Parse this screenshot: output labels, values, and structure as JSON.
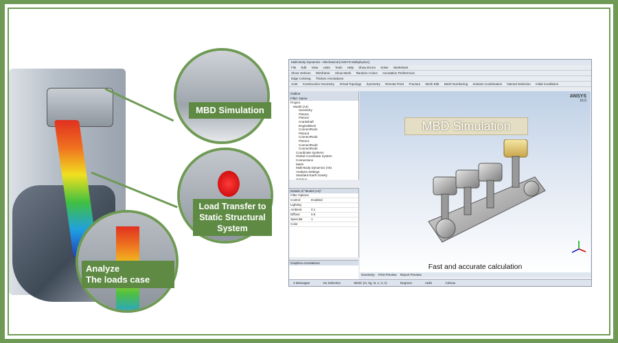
{
  "illustration": {
    "labels": {
      "mbd_simulation": "MBD Simulation",
      "load_transfer": [
        "Load Transfer to",
        "Static Structural",
        "System"
      ],
      "analyze": [
        "Analyze",
        "The loads case"
      ]
    }
  },
  "app": {
    "title": "Multi-Body Dynamics - Mechanical [ANSYS Multiphysics]",
    "menu": [
      "File",
      "Edit",
      "View",
      "Units",
      "Tools",
      "Help"
    ],
    "toolbar1": [
      "Show Errors",
      "Solve",
      "Worksheet"
    ],
    "toolbar2": [
      "Show Vertices",
      "Wireframe",
      "Show Mesh",
      "Random Colors",
      "Annotation Preferences"
    ],
    "toolbar3": [
      "Edge Coloring",
      "Thicken Annotations"
    ],
    "toolbar4": [
      "Joint",
      "Construction Geometry",
      "Virtual Topology",
      "Symmetry",
      "Remote Point",
      "Fracture",
      "Mesh Edit",
      "Mesh Numbering",
      "Solution Combination",
      "Named Selection",
      "Initial Conditions"
    ],
    "tree_header": [
      "Filter:",
      "Name"
    ],
    "tree_title": "Outline",
    "tree": [
      "Project",
      "Model (A4)",
      "Geometry",
      "Piston1",
      "Piston2",
      "Crankshaft",
      "EngineBlock",
      "ConnectRod1",
      "Piston3",
      "ConnectRod2",
      "Piston4",
      "ConnectRod3",
      "ConnectRod4",
      "Coordinate Systems",
      "Global Coordinate System",
      "Connections",
      "Mesh",
      "Multi-Body Dynamics (A5)",
      "Analysis Settings",
      "Standard Earth Gravity",
      "Solution",
      "Results",
      "Simulation"
    ],
    "details_title": "Details of \"Model (A4)\"",
    "details": [
      {
        "k": "Filter Options",
        "v": ""
      },
      {
        "k": "Control",
        "v": "Enabled"
      },
      {
        "k": "Lighting",
        "v": ""
      },
      {
        "k": "Ambient",
        "v": "0.1"
      },
      {
        "k": "Diffuse",
        "v": "0.6"
      },
      {
        "k": "Specular",
        "v": "1"
      },
      {
        "k": "Color",
        "v": ""
      }
    ],
    "section_title": "Graphics Annotations",
    "viewport": {
      "banner": "MBD Simulation",
      "logo": "ANSYS",
      "version": "16.0",
      "caption": "Fast and accurate calculation"
    },
    "bottom_tabs": [
      "Geometry",
      "Print Preview",
      "Report Preview"
    ],
    "status": [
      "2 Messages",
      "No Selection",
      "Metric (m, kg, N, s, V, A)",
      "Degrees",
      "rad/s",
      "Celsius"
    ]
  },
  "colors": {
    "frame": "#6f9a55",
    "label_bg": "#5e8a43"
  }
}
